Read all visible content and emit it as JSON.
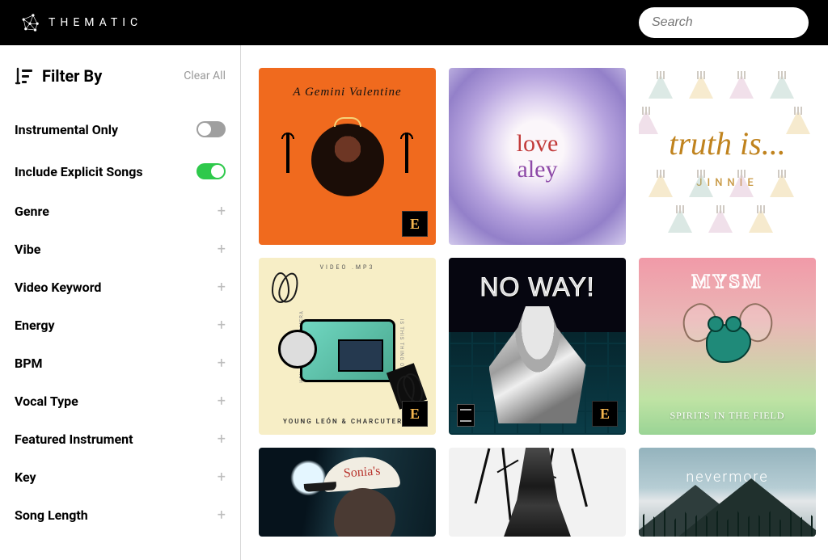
{
  "header": {
    "brand": "THEMATIC",
    "search_placeholder": "Search"
  },
  "sidebar": {
    "title": "Filter By",
    "clear": "Clear All",
    "toggles": [
      {
        "label": "Instrumental Only",
        "on": false
      },
      {
        "label": "Include Explicit Songs",
        "on": true
      }
    ],
    "categories": [
      {
        "label": "Genre"
      },
      {
        "label": "Vibe"
      },
      {
        "label": "Video Keyword"
      },
      {
        "label": "Energy"
      },
      {
        "label": "BPM"
      },
      {
        "label": "Vocal Type"
      },
      {
        "label": "Featured Instrument"
      },
      {
        "label": "Key"
      },
      {
        "label": "Song Length"
      }
    ]
  },
  "albums": [
    {
      "title_top": "A Gemini Valentine",
      "explicit": true
    },
    {
      "line1": "love",
      "line2": "aley"
    },
    {
      "truth": "truth is...",
      "artist": "JINNIE"
    },
    {
      "top": "VIDEO .MP3",
      "bottom": "YOUNG LEÓN & CHARCUTERIE",
      "side_l": "HEY, YOU'RE ON CAMERA",
      "side_r": "IS THIS THING ON?",
      "explicit": true
    },
    {
      "title": "NO WAY!",
      "explicit": true,
      "parental": true
    },
    {
      "brand": "MYSM",
      "sub": "SPIRITS IN THE FIELD"
    },
    {
      "cap": "Sonia's"
    },
    {},
    {
      "title": "nevermore",
      "sub": ""
    }
  ],
  "explicit_glyph": "E"
}
